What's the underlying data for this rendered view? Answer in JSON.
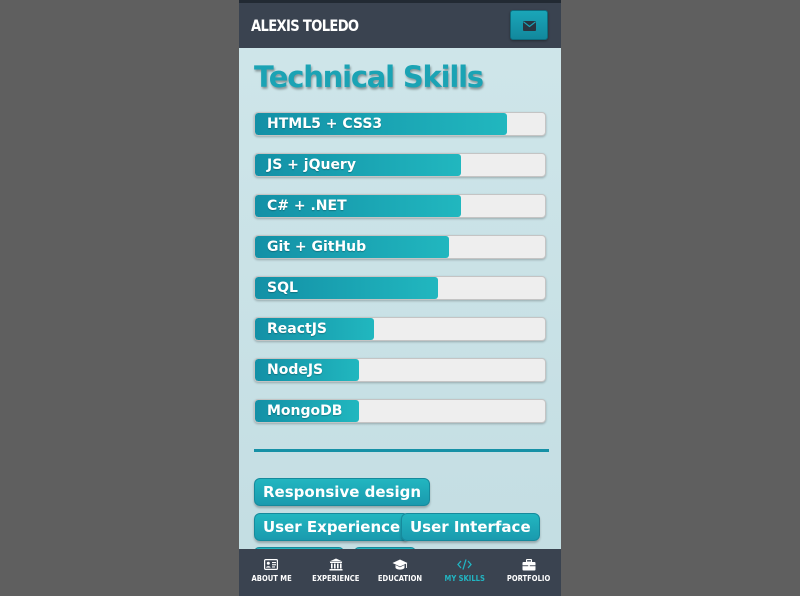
{
  "header": {
    "brand": "ALEXIS TOLEDO",
    "mail_icon": "envelope-icon"
  },
  "section": {
    "title": "Technical Skills"
  },
  "skills": [
    {
      "label": "HTML5 + CSS3",
      "level": 0.87
    },
    {
      "label": "JS + jQuery",
      "level": 0.71
    },
    {
      "label": "C# + .NET",
      "level": 0.71
    },
    {
      "label": "Git + GitHub",
      "level": 0.67
    },
    {
      "label": "SQL",
      "level": 0.63
    },
    {
      "label": "ReactJS",
      "level": 0.41
    },
    {
      "label": "NodeJS",
      "level": 0.36
    },
    {
      "label": "MongoDB",
      "level": 0.36
    }
  ],
  "tags": [
    "Responsive design",
    "User Experience",
    "User Interface"
  ],
  "nav": [
    {
      "label": "ABOUT ME",
      "icon": "id-card-icon",
      "active": false
    },
    {
      "label": "EXPERIENCE",
      "icon": "institution-icon",
      "active": false
    },
    {
      "label": "EDUCATION",
      "icon": "graduation-cap-icon",
      "active": false
    },
    {
      "label": "MY SKILLS",
      "icon": "code-icon",
      "active": true
    },
    {
      "label": "PORTFOLIO",
      "icon": "briefcase-icon",
      "active": false
    }
  ],
  "colors": {
    "accent": "#1ba3b4",
    "bar_bg": "#eeeeee",
    "nav_bg": "#3a4350",
    "active": "#21b5c2"
  }
}
